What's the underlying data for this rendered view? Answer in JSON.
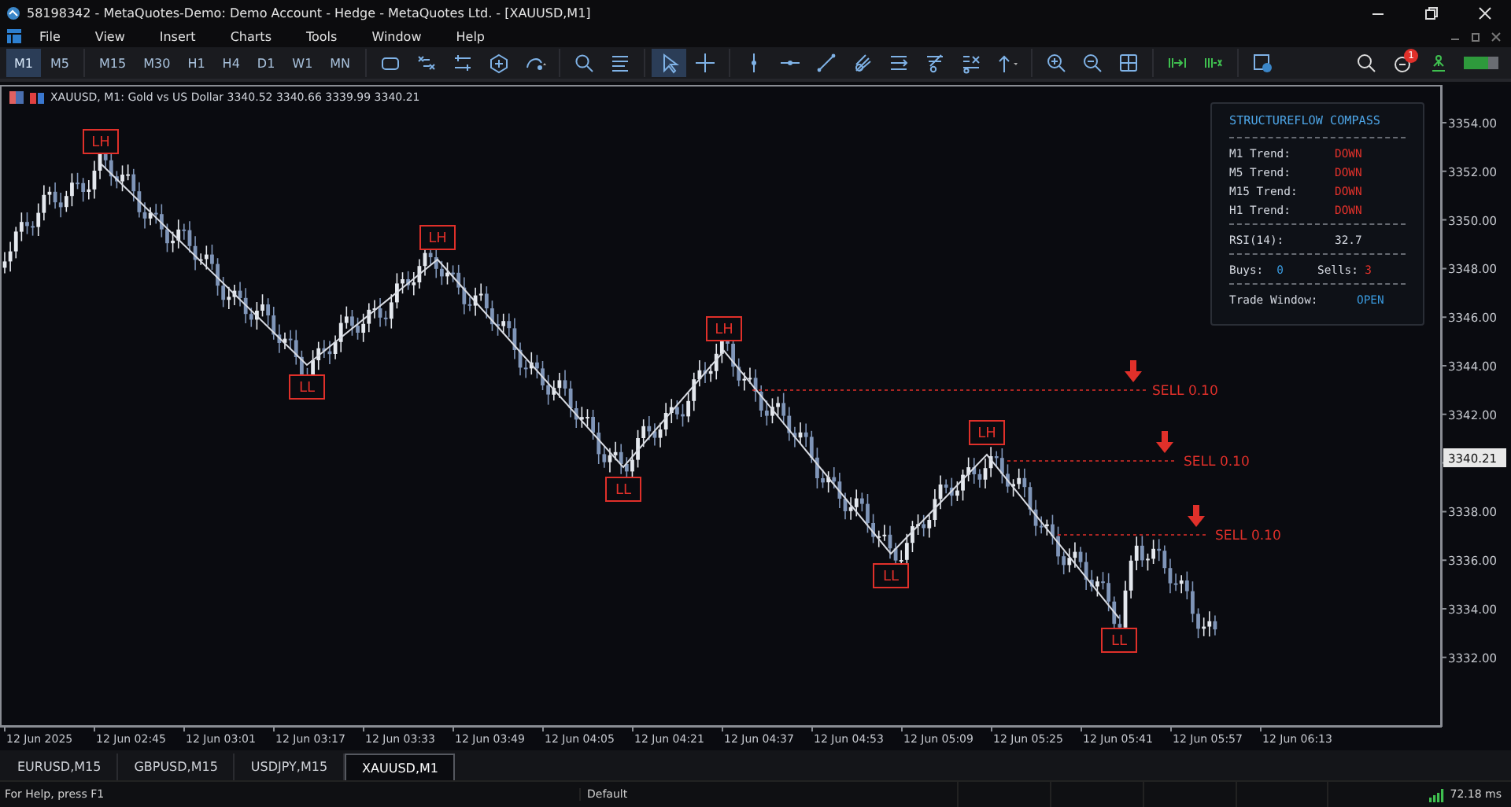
{
  "window": {
    "title": "58198342 - MetaQuotes-Demo: Demo Account - Hedge - MetaQuotes Ltd. - [XAUUSD,M1]"
  },
  "menu": [
    "File",
    "View",
    "Insert",
    "Charts",
    "Tools",
    "Window",
    "Help"
  ],
  "toolbar": {
    "timeframes": [
      {
        "label": "M1",
        "selected": true
      },
      {
        "label": "M5",
        "selected": false
      },
      {
        "label": "M15",
        "selected": false
      },
      {
        "label": "M30",
        "selected": false
      },
      {
        "label": "H1",
        "selected": false
      },
      {
        "label": "H4",
        "selected": false
      },
      {
        "label": "D1",
        "selected": false
      },
      {
        "label": "W1",
        "selected": false
      },
      {
        "label": "MN",
        "selected": false
      }
    ],
    "notification_count": "1"
  },
  "chart": {
    "header": "XAUUSD, M1:  Gold vs US Dollar  3340.52 3340.66 3339.99 3340.21",
    "price_axis": [
      "3354.00",
      "3352.00",
      "3350.00",
      "3348.00",
      "3346.00",
      "3344.00",
      "3342.00",
      "3338.00",
      "3336.00",
      "3334.00",
      "3332.00"
    ],
    "current_price": "3340.21",
    "time_axis": [
      "12 Jun 2025",
      "12 Jun 02:45",
      "12 Jun 03:01",
      "12 Jun 03:17",
      "12 Jun 03:33",
      "12 Jun 03:49",
      "12 Jun 04:05",
      "12 Jun 04:21",
      "12 Jun 04:37",
      "12 Jun 04:53",
      "12 Jun 05:09",
      "12 Jun 05:25",
      "12 Jun 05:41",
      "12 Jun 05:57",
      "12 Jun 06:13"
    ],
    "pivots": [
      {
        "kind": "high",
        "text": "LH"
      },
      {
        "kind": "low",
        "text": "LL"
      },
      {
        "kind": "high",
        "text": "LH"
      },
      {
        "kind": "low",
        "text": "LL"
      },
      {
        "kind": "high",
        "text": "LH"
      },
      {
        "kind": "low",
        "text": "LL"
      },
      {
        "kind": "high",
        "text": "LH"
      },
      {
        "kind": "low",
        "text": "LL"
      }
    ],
    "signals": [
      {
        "kind": "sell",
        "text": "SELL 0.10"
      },
      {
        "kind": "sell",
        "text": "SELL 0.10"
      },
      {
        "kind": "sell",
        "text": "SELL 0.10"
      }
    ],
    "indicator_panel": {
      "title": "STRUCTUREFLOW COMPASS",
      "sections": [
        {
          "rows": [
            [
              {
                "label": "M1 Trend:",
                "value": "DOWN",
                "color": "#e5322b"
              }
            ],
            [
              {
                "label": "M5 Trend:",
                "value": "DOWN",
                "color": "#e5322b"
              }
            ],
            [
              {
                "label": "M15 Trend:",
                "value": "DOWN",
                "color": "#e5322b"
              }
            ],
            [
              {
                "label": "H1 Trend:",
                "value": "DOWN",
                "color": "#e5322b"
              }
            ]
          ]
        },
        {
          "rows": [
            [
              {
                "label": "RSI(14):",
                "value": "32.7",
                "color": "#d4d8e0"
              }
            ]
          ]
        },
        {
          "rows": [
            [
              {
                "label": "Buys:",
                "value": "0",
                "color": "#3a9be0"
              },
              {
                "label": "Sells:",
                "value": "3",
                "color": "#e5322b"
              }
            ]
          ]
        },
        {
          "rows": [
            [
              {
                "label": "Trade Window:",
                "value": "OPEN",
                "color": "#3a9be0"
              }
            ]
          ]
        }
      ]
    }
  },
  "chart_tabs": [
    {
      "label": "EURUSD,M15",
      "selected": false
    },
    {
      "label": "GBPUSD,M15",
      "selected": false
    },
    {
      "label": "USDJPY,M15",
      "selected": false
    },
    {
      "label": "XAUUSD,M1",
      "selected": true
    }
  ],
  "status_bar": {
    "help": "For Help, press F1",
    "profile": "Default",
    "ping": "72.18 ms"
  }
}
